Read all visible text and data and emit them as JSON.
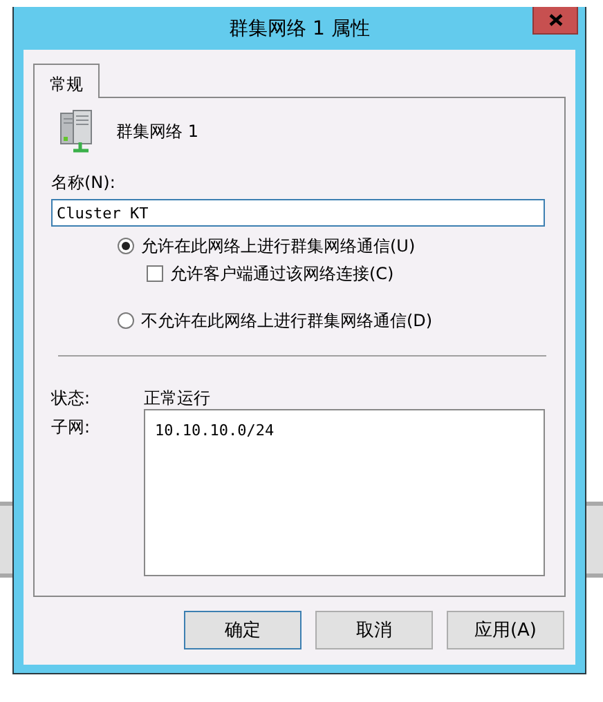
{
  "window": {
    "title": "群集网络 1 属性"
  },
  "tabs": [
    {
      "label": "常规",
      "selected": true
    }
  ],
  "header": {
    "name": "群集网络 1"
  },
  "name_field": {
    "label": "名称(N):",
    "value": "Cluster KT"
  },
  "options": [
    {
      "kind": "radio",
      "label": "允许在此网络上进行群集网络通信(U)",
      "selected": true
    },
    {
      "kind": "checkbox",
      "label": "允许客户端通过该网络连接(C)",
      "checked": false
    },
    {
      "kind": "radio",
      "label": "不允许在此网络上进行群集网络通信(D)",
      "selected": false
    }
  ],
  "status": {
    "label": "状态:",
    "value": "正常运行"
  },
  "subnets": {
    "label": "子网:",
    "items": [
      "10.10.10.0/24"
    ]
  },
  "buttons": [
    {
      "label": "确定",
      "focused": true
    },
    {
      "label": "取消",
      "focused": false
    },
    {
      "label": "应用(A)",
      "focused": false
    }
  ]
}
